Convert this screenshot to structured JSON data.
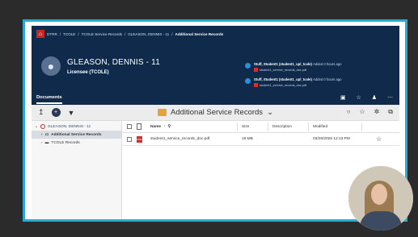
{
  "breadcrumb": [
    "DTRR",
    "TCOLE",
    "TCOLE Service Records",
    "GLEASON, DENNIS - 11",
    "Additional Service Records"
  ],
  "profile": {
    "name": "GLEASON, DENNIS - 11",
    "role": "Licensee (TCOLE)"
  },
  "notifications": [
    {
      "title": "Stuff, Student1 (student1_upl_tcole)",
      "time": "Added 0 hours ago",
      "file": "student1_service_records_doc.pdf"
    },
    {
      "title": "Stuff, Student1 (student1_upl_tcole)",
      "time": "Added 0 hours ago",
      "file": "student1_service_records_doc.pdf"
    }
  ],
  "tabs": {
    "documents": "Documents"
  },
  "toolbar": {
    "folder_title": "Additional Service Records",
    "chevron": "⌄"
  },
  "sidebar": {
    "items": [
      {
        "label": "GLEASON, DENNIS - 11",
        "icon": "person-icon"
      },
      {
        "label": "Additional Service Records",
        "icon": "folder-icon"
      },
      {
        "label": "TCOLE Records",
        "icon": "folder-icon"
      }
    ]
  },
  "table": {
    "headers": {
      "name": "Name",
      "size": "Size",
      "description": "Description",
      "modified": "Modified"
    },
    "rows": [
      {
        "name": "student1_service_records_doc.pdf",
        "size": "19 MB",
        "description": "",
        "modified": "03/25/2026 12:13 PM"
      }
    ]
  },
  "colors": {
    "header_bg": "#0f2a4a",
    "frame_border": "#2aa9d6",
    "pdf_red": "#d32f2f",
    "folder": "#e9a23b"
  }
}
